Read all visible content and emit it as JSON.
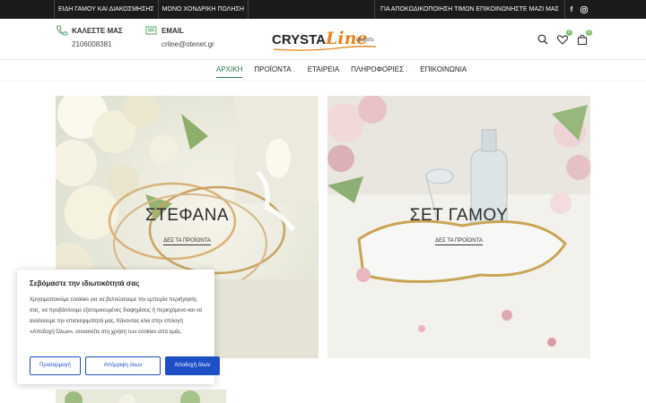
{
  "topbar": {
    "items": [
      "ΕΙΔΗ ΓΑΜΟΥ ΚΑΙ ΔΙΑΚΟΣΜΗΣΗΣ",
      "ΜΟΝΟ ΧΟΝΔΡΙΚΗ ΠΩΛΗΣΗ"
    ],
    "promo": "ΓΙΑ ΑΠΟΚΩΔΙΚΟΠΟΙΗΣΗ ΤΙΜΩΝ ΕΠΙΚΟΙΝΩΝΗΣΤΕ ΜΑΖΙ ΜΑΣ",
    "social": [
      "f",
      "instagram-icon"
    ]
  },
  "header": {
    "phone_label": "ΚΑΛΕΣΤΕ ΜΑΣ",
    "phone_value": "2106008381",
    "email_label": "EMAIL",
    "email_value": "crline@otenet.gr",
    "logo": {
      "part1": "CRYSTA",
      "part2": "Line",
      "part3": "imports"
    },
    "wishlist_count": "0",
    "cart_count": "0"
  },
  "nav": {
    "items": [
      {
        "label": "ΑΡΧΙΚΗ",
        "dropdown": false
      },
      {
        "label": "ΠΡΟΪΟΝΤΑ",
        "dropdown": true
      },
      {
        "label": "ΕΤΑΙΡΕΙΑ",
        "dropdown": false
      },
      {
        "label": "ΠΛΗΡΟΦΟΡΙΕΣ",
        "dropdown": true
      },
      {
        "label": "ΕΠΙΚΟΙΝΩΝΙΑ",
        "dropdown": false
      }
    ],
    "caret": "⌄"
  },
  "banners": [
    {
      "title": "ΣΤΕΦΑΝΑ",
      "cta": "ΔΕΣ ΤΑ ΠΡΟΪΟΝΤΑ"
    },
    {
      "title": "ΣΕΤ ΓΑΜΟΥ",
      "cta": "ΔΕΣ ΤΑ ΠΡΟΪΟΝΤΑ"
    }
  ],
  "cookie": {
    "title": "Σεβόμαστε την ιδιωτικότητά σας",
    "text": "Χρησιμοποιούμε cookies για να βελτιώσουμε την εμπειρία περιήγησής σας, να προβάλλουμε εξατομικευμένες διαφημίσεις ή περιεχόμενο και να αναλύουμε την επισκεψιμότητά μας. Κάνοντας κλικ στην επιλογή «Αποδοχή Όλων», συναινείτε στη χρήση των cookies από εμάς.",
    "customize": "Προσαρμογή",
    "reject": "Απόρριψη όλων",
    "accept": "Αποδοχή όλων"
  },
  "colors": {
    "accent_green": "#2a7a4b",
    "logo_orange": "#e8821a",
    "button_blue": "#1e4fc6",
    "topbar_bg": "#1b1b1b"
  }
}
